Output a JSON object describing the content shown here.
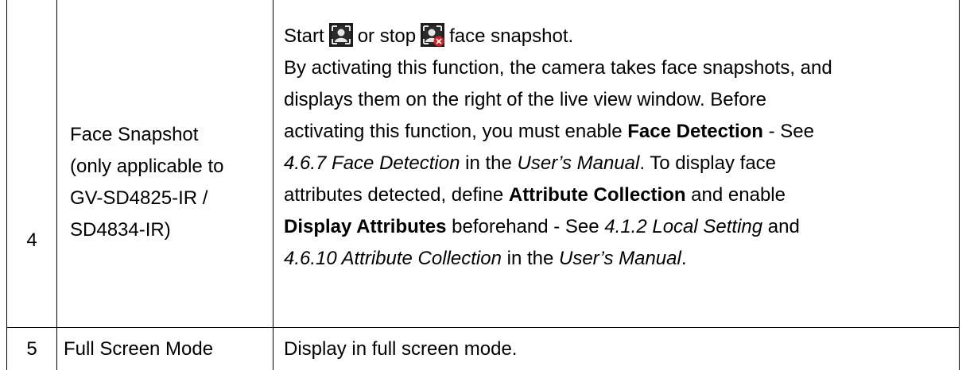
{
  "rows": [
    {
      "number": "4",
      "feature": [
        "Face Snapshot",
        "(only applicable to",
        "GV-SD4825-IR /",
        "SD4834-IR)"
      ],
      "description": {
        "start_word": "Start",
        "start_icon": "face-snapshot-start-icon",
        "or_stop": "or stop",
        "stop_icon": "face-snapshot-stop-icon",
        "start_stop_tail": "face snapshot.",
        "l1": "By activating this function, the camera takes face snapshots, and",
        "l2": "displays them on the right of the live view window. Before",
        "l3_a": "activating this function, you must enable ",
        "l3_b": "Face Detection",
        "l3_c": " - See",
        "l4_a": "4.6.7 Face Detection",
        "l4_b": " in the ",
        "l4_c": "User’s Manual",
        "l4_d": ". To display face",
        "l5_a": "attributes detected, define ",
        "l5_b": "Attribute Collection",
        "l5_c": " and enable",
        "l6_a": "Display Attributes",
        "l6_b": " beforehand - See ",
        "l6_c": "4.1.2 Local Setting",
        "l6_d": " and",
        "l7_a": "4.6.10 Attribute Collection",
        "l7_b": " in the ",
        "l7_c": "User’s Manual",
        "l7_d": "."
      }
    },
    {
      "number": "5",
      "feature": [
        "Full Screen Mode"
      ],
      "description": {
        "text": "Display in full screen mode."
      }
    }
  ],
  "colors": {
    "icon_dark": "#1c1c1c",
    "icon_light": "#c8c8c8",
    "stop_badge": "#d81e1e"
  }
}
